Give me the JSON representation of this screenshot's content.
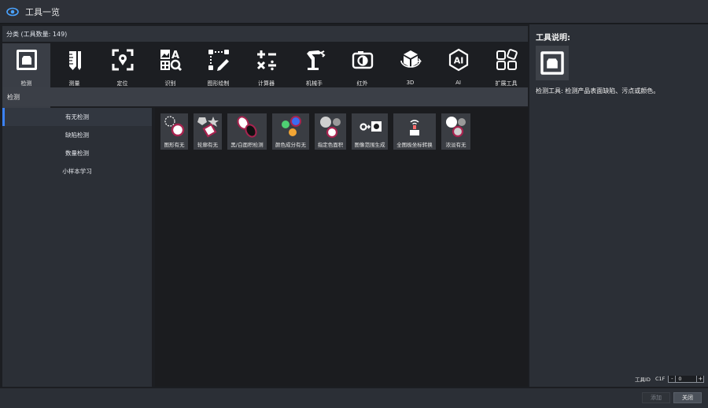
{
  "window": {
    "title": "工具一览"
  },
  "category_bar": {
    "text": "分类 (工具数量: 149)"
  },
  "categories": [
    {
      "label": "检测",
      "icon": "inspect-icon",
      "active": true
    },
    {
      "label": "测量",
      "icon": "ruler-icon"
    },
    {
      "label": "定位",
      "icon": "locate-icon"
    },
    {
      "label": "识别",
      "icon": "recognize-icon"
    },
    {
      "label": "图形绘制",
      "icon": "draw-icon"
    },
    {
      "label": "计算器",
      "icon": "calculator-icon"
    },
    {
      "label": "机械手",
      "icon": "robot-arm-icon"
    },
    {
      "label": "红外",
      "icon": "infrared-icon"
    },
    {
      "label": "3D",
      "icon": "3d-icon"
    },
    {
      "label": "AI",
      "icon": "ai-icon"
    },
    {
      "label": "扩展工具",
      "icon": "extension-icon"
    }
  ],
  "section": {
    "title": "检测"
  },
  "subcategories": [
    {
      "label": "有无检测",
      "active": true
    },
    {
      "label": "缺陷检测"
    },
    {
      "label": "数量检测"
    },
    {
      "label": "小样本学习"
    }
  ],
  "tools": [
    {
      "label": "图形有无",
      "icon": "shape-presence-icon"
    },
    {
      "label": "轮廓有无",
      "icon": "contour-presence-icon"
    },
    {
      "label": "黑/白面积检测",
      "icon": "bw-area-icon"
    },
    {
      "label": "颜色成分有无",
      "icon": "color-component-icon"
    },
    {
      "label": "指定色面积",
      "icon": "specified-color-area-icon"
    },
    {
      "label": "图像范围生成",
      "icon": "image-range-icon"
    },
    {
      "label": "全图极坐标转换",
      "icon": "polar-transform-icon"
    },
    {
      "label": "浓淡有无",
      "icon": "shade-presence-icon"
    }
  ],
  "description": {
    "title": "工具说明:",
    "text": "检测工具: 检测产品表面缺陷、污点或颜色。"
  },
  "tool_id": {
    "label": "工具ID",
    "prefix": "C1F",
    "value": "0",
    "minus": "-",
    "plus": "+"
  },
  "buttons": {
    "add": "添加",
    "close": "关闭"
  },
  "colors": {
    "accent": "#3b82f6",
    "background": "#1c1e22",
    "panel": "#2b2f36",
    "highlight_ring": "#a8234f"
  }
}
